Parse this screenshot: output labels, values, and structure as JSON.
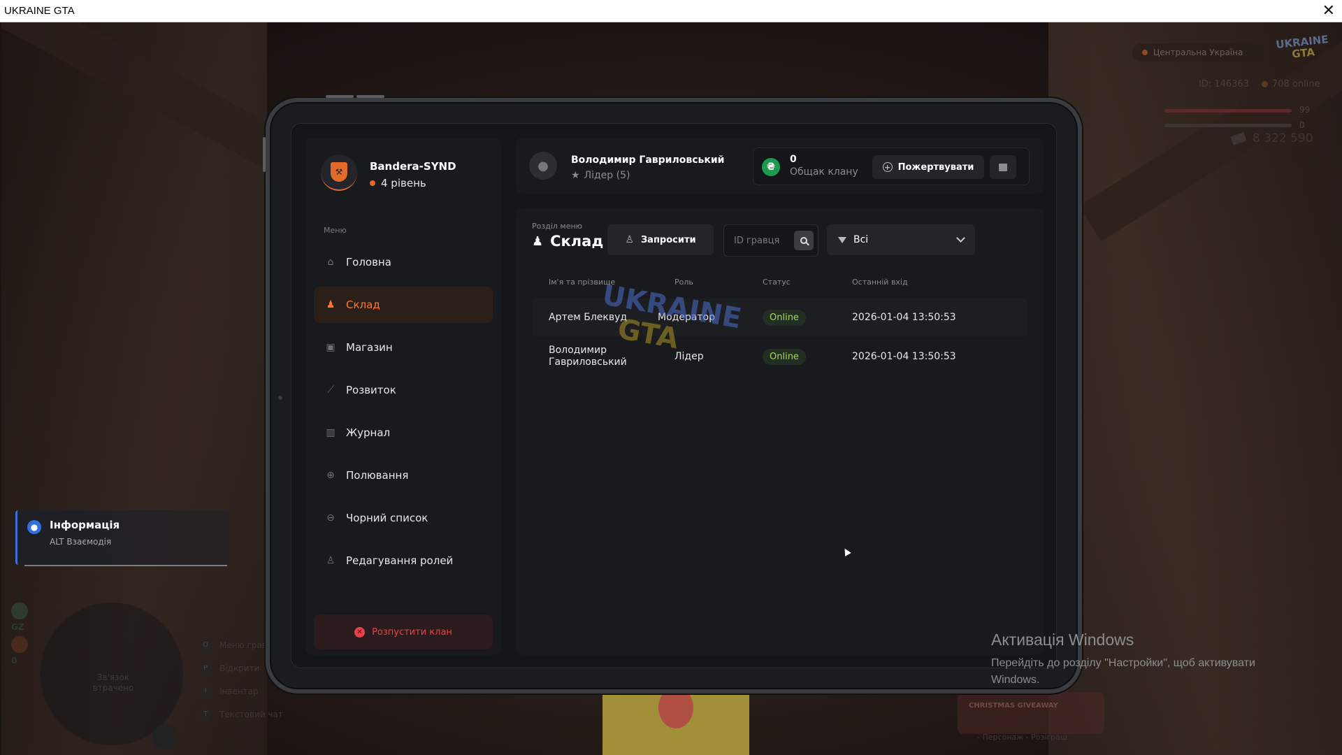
{
  "window": {
    "title": "UKRAINE GTA",
    "close_symbol": "✕"
  },
  "hud": {
    "server_name": "Центральна Україна",
    "logo_top": "UKRAINE",
    "logo_bottom": "GTA",
    "player_id": "ID: 146363",
    "online": "708 online",
    "health": "99",
    "armor": "0",
    "money": "8 322 590",
    "gz_label": "GZ",
    "gz_value": "0",
    "voice_text": "Зв'язок втрачено",
    "key_hints": [
      {
        "key": "O",
        "label": "Меню гравця"
      },
      {
        "key": "P",
        "label": "Відкрити"
      },
      {
        "key": "I",
        "label": "Інвентар"
      },
      {
        "key": "T",
        "label": "Текстовий чат"
      }
    ],
    "xmas_title": "CHRISTMAS GIVEAWAY",
    "xmas_sub": "- Персонаж - Розіграш"
  },
  "notification": {
    "title": "Інформація",
    "text": "ALT Взаємодія"
  },
  "windows_activation": {
    "title": "Активація Windows",
    "text": "Перейдіть до розділу \"Настройки\", щоб активувати Windows."
  },
  "clan": {
    "name": "Bandera-SYND",
    "level": "4 рівень"
  },
  "menu": {
    "caption": "Меню",
    "items": [
      {
        "label": "Головна",
        "icon": "home-icon",
        "active": false
      },
      {
        "label": "Склад",
        "icon": "members-icon",
        "active": true
      },
      {
        "label": "Магазин",
        "icon": "shop-icon",
        "active": false
      },
      {
        "label": "Розвиток",
        "icon": "chart-icon",
        "active": false
      },
      {
        "label": "Журнал",
        "icon": "book-icon",
        "active": false
      },
      {
        "label": "Полювання",
        "icon": "crosshair-icon",
        "active": false
      },
      {
        "label": "Чорний список",
        "icon": "block-icon",
        "active": false
      },
      {
        "label": "Редагування ролей",
        "icon": "user-edit-icon",
        "active": false
      }
    ],
    "disband_label": "Розпустити клан"
  },
  "header": {
    "user_name": "Володимир Гавриловський",
    "user_role": "Лідер (5)",
    "bank_value": "0",
    "bank_label": "Общак клану",
    "bank_symbol": "₴",
    "donate_label": "Пожертвувати"
  },
  "section": {
    "caption": "Розділ меню",
    "title": "Склад",
    "invite_label": "Запросити",
    "id_placeholder": "ID гравця",
    "filter_value": "Всі"
  },
  "table": {
    "columns": [
      "Ім'я та прізвище",
      "Роль",
      "Статус",
      "Останній вхід"
    ],
    "rows": [
      {
        "name": "Артем Блеквуд",
        "role": "Модератор",
        "status": "Online",
        "last_login": "2026-01-04 13:50:53"
      },
      {
        "name": "Володимир Гавриловський",
        "role": "Лідер",
        "status": "Online",
        "last_login": "2026-01-04 13:50:53"
      }
    ]
  },
  "watermark": {
    "top": "UKRAINE",
    "bottom": "GTA"
  },
  "colors": {
    "accent": "#ff7a2e",
    "danger": "#e8434a",
    "online": "#a8d65a",
    "bank_green": "#1e9a4e"
  }
}
